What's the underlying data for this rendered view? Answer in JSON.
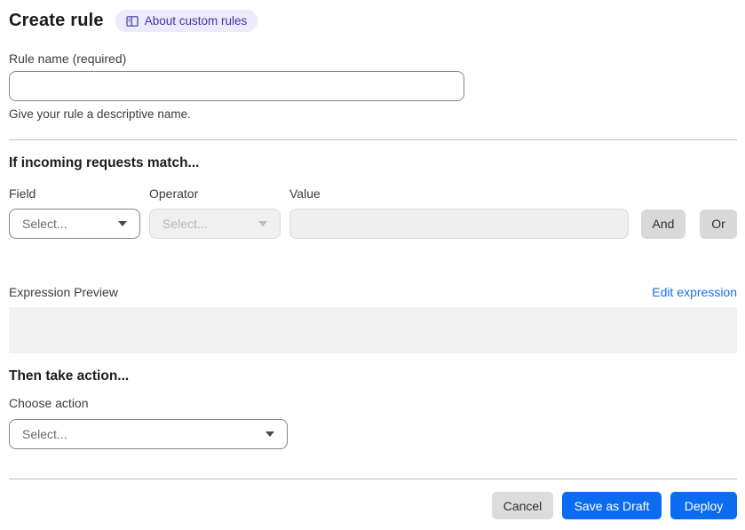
{
  "header": {
    "title": "Create rule",
    "about_badge_label": "About custom rules"
  },
  "rule_name": {
    "label": "Rule name (required)",
    "value": "",
    "helper": "Give your rule a descriptive name."
  },
  "match_section": {
    "heading": "If incoming requests match...",
    "field_label": "Field",
    "operator_label": "Operator",
    "value_label": "Value",
    "field_selected": "Select...",
    "operator_selected": "Select...",
    "value_value": "",
    "and_button": "And",
    "or_button": "Or",
    "expression_preview_label": "Expression Preview",
    "edit_expression_link": "Edit expression",
    "expression_preview_value": ""
  },
  "action_section": {
    "heading": "Then take action...",
    "choose_action_label": "Choose action",
    "action_selected": "Select..."
  },
  "footer": {
    "cancel_label": "Cancel",
    "save_draft_label": "Save as Draft",
    "deploy_label": "Deploy"
  },
  "icons": {
    "badge_icon": "book-icon",
    "select_arrow": "caret-down-icon"
  },
  "colors": {
    "primary_blue": "#0b6cf2",
    "link_blue": "#1a70e8",
    "badge_bg": "#eceafb",
    "badge_text": "#3a3aa0",
    "chip_gray": "#d9d9d9",
    "disabled_bg": "#f0f0f0",
    "preview_bg": "#f1f1f1"
  }
}
